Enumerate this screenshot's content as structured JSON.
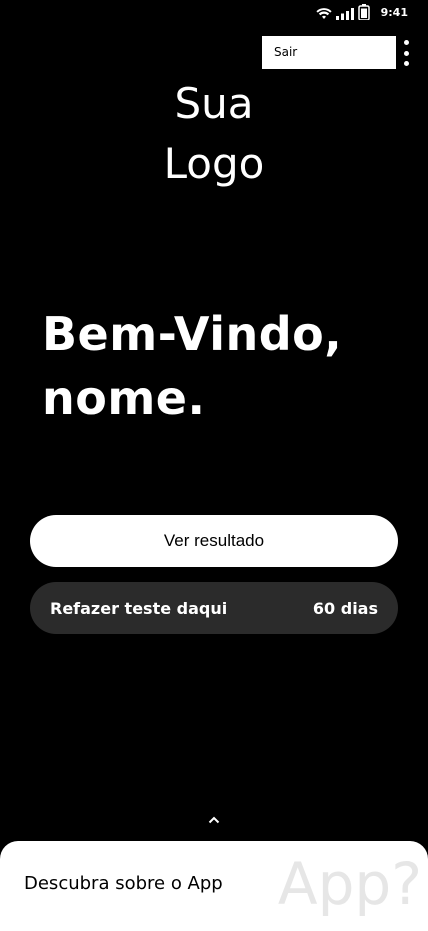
{
  "status_bar": {
    "time": "9:41",
    "icons": [
      "wifi-icon",
      "signal-icon",
      "battery-icon"
    ]
  },
  "menu": {
    "logout_label": "Sair",
    "overflow_icon": "more-vertical-icon"
  },
  "logo": {
    "line1": "Sua",
    "line2": "Logo"
  },
  "welcome": {
    "line1": "Bem-Vindo,",
    "line2": "nome."
  },
  "actions": {
    "result_label": "Ver resultado",
    "retake_label": "Refazer teste daqui",
    "retake_value": "60 dias"
  },
  "bottom_sheet": {
    "expand_icon": "chevron-up-icon",
    "label": "Descubra sobre o App",
    "watermark": "App?"
  },
  "colors": {
    "background": "#000000",
    "primary_button": "#ffffff",
    "secondary_button": "#2b2b2b",
    "sheet": "#ffffff"
  }
}
